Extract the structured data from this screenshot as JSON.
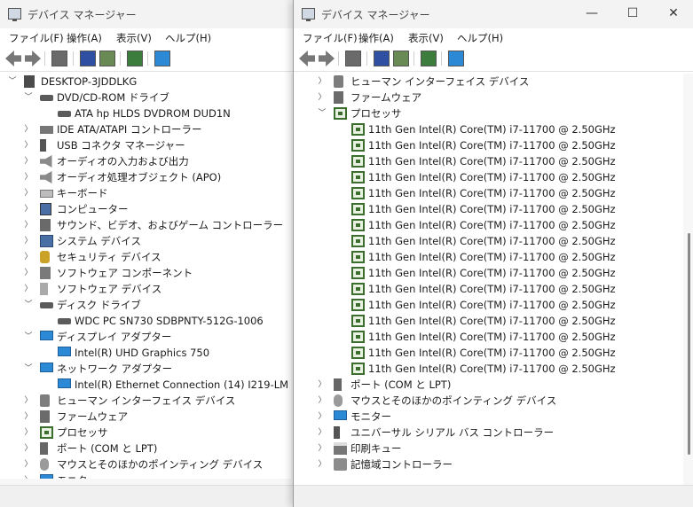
{
  "left": {
    "title": "デバイス マネージャー",
    "menus": [
      "ファイル(F)",
      "操作(A)",
      "表示(V)",
      "ヘルプ(H)"
    ],
    "root": "DESKTOP-3JDDLKG",
    "items": [
      {
        "label": "DVD/CD-ROM ドライブ",
        "state": "expanded",
        "icon": "dvd-drive-icon"
      },
      {
        "label": "ATA hp HLDS DVDROM DUD1N",
        "state": "leaf",
        "icon": "dvd-drive-icon"
      },
      {
        "label": "IDE ATA/ATAPI コントローラー",
        "state": "collapsed",
        "icon": "ide-controller-icon"
      },
      {
        "label": "USB コネクタ マネージャー",
        "state": "collapsed",
        "icon": "usb-icon"
      },
      {
        "label": "オーディオの入力および出力",
        "state": "collapsed",
        "icon": "speaker-icon"
      },
      {
        "label": "オーディオ処理オブジェクト (APO)",
        "state": "collapsed",
        "icon": "speaker-icon"
      },
      {
        "label": "キーボード",
        "state": "collapsed",
        "icon": "keyboard-icon"
      },
      {
        "label": "コンピューター",
        "state": "collapsed",
        "icon": "computer-icon"
      },
      {
        "label": "サウンド、ビデオ、およびゲーム コントローラー",
        "state": "collapsed",
        "icon": "sound-icon"
      },
      {
        "label": "システム デバイス",
        "state": "collapsed",
        "icon": "system-device-icon"
      },
      {
        "label": "セキュリティ デバイス",
        "state": "collapsed",
        "icon": "security-icon"
      },
      {
        "label": "ソフトウェア コンポーネント",
        "state": "collapsed",
        "icon": "software-component-icon"
      },
      {
        "label": "ソフトウェア デバイス",
        "state": "collapsed",
        "icon": "software-device-icon"
      },
      {
        "label": "ディスク ドライブ",
        "state": "expanded",
        "icon": "disk-drive-icon"
      },
      {
        "label": "WDC PC SN730 SDBPNTY-512G-1006",
        "state": "leaf",
        "icon": "disk-drive-icon"
      },
      {
        "label": "ディスプレイ アダプター",
        "state": "expanded",
        "icon": "display-adapter-icon"
      },
      {
        "label": "Intel(R) UHD Graphics 750",
        "state": "leaf",
        "icon": "display-adapter-icon"
      },
      {
        "label": "ネットワーク アダプター",
        "state": "expanded",
        "icon": "network-adapter-icon"
      },
      {
        "label": "Intel(R) Ethernet Connection (14) I219-LM",
        "state": "leaf",
        "icon": "network-adapter-icon"
      },
      {
        "label": "ヒューマン インターフェイス デバイス",
        "state": "collapsed",
        "icon": "hid-icon"
      },
      {
        "label": "ファームウェア",
        "state": "collapsed",
        "icon": "firmware-icon"
      },
      {
        "label": "プロセッサ",
        "state": "collapsed",
        "icon": "processor-icon"
      },
      {
        "label": "ポート (COM と LPT)",
        "state": "collapsed",
        "icon": "port-icon"
      },
      {
        "label": "マウスとそのほかのポインティング デバイス",
        "state": "collapsed",
        "icon": "mouse-icon"
      },
      {
        "label": "モニター",
        "state": "collapsed",
        "icon": "monitor-icon"
      }
    ]
  },
  "right": {
    "title": "デバイス マネージャー",
    "menus": [
      "ファイル(F)",
      "操作(A)",
      "表示(V)",
      "ヘルプ(H)"
    ],
    "items": [
      {
        "label": "ヒューマン インターフェイス デバイス",
        "state": "collapsed",
        "icon": "hid-icon"
      },
      {
        "label": "ファームウェア",
        "state": "collapsed",
        "icon": "firmware-icon"
      },
      {
        "label": "プロセッサ",
        "state": "expanded",
        "icon": "processor-icon"
      },
      {
        "label": "11th Gen Intel(R) Core(TM) i7-11700 @ 2.50GHz",
        "state": "leaf",
        "icon": "processor-icon"
      },
      {
        "label": "11th Gen Intel(R) Core(TM) i7-11700 @ 2.50GHz",
        "state": "leaf",
        "icon": "processor-icon"
      },
      {
        "label": "11th Gen Intel(R) Core(TM) i7-11700 @ 2.50GHz",
        "state": "leaf",
        "icon": "processor-icon"
      },
      {
        "label": "11th Gen Intel(R) Core(TM) i7-11700 @ 2.50GHz",
        "state": "leaf",
        "icon": "processor-icon"
      },
      {
        "label": "11th Gen Intel(R) Core(TM) i7-11700 @ 2.50GHz",
        "state": "leaf",
        "icon": "processor-icon"
      },
      {
        "label": "11th Gen Intel(R) Core(TM) i7-11700 @ 2.50GHz",
        "state": "leaf",
        "icon": "processor-icon"
      },
      {
        "label": "11th Gen Intel(R) Core(TM) i7-11700 @ 2.50GHz",
        "state": "leaf",
        "icon": "processor-icon"
      },
      {
        "label": "11th Gen Intel(R) Core(TM) i7-11700 @ 2.50GHz",
        "state": "leaf",
        "icon": "processor-icon"
      },
      {
        "label": "11th Gen Intel(R) Core(TM) i7-11700 @ 2.50GHz",
        "state": "leaf",
        "icon": "processor-icon"
      },
      {
        "label": "11th Gen Intel(R) Core(TM) i7-11700 @ 2.50GHz",
        "state": "leaf",
        "icon": "processor-icon"
      },
      {
        "label": "11th Gen Intel(R) Core(TM) i7-11700 @ 2.50GHz",
        "state": "leaf",
        "icon": "processor-icon"
      },
      {
        "label": "11th Gen Intel(R) Core(TM) i7-11700 @ 2.50GHz",
        "state": "leaf",
        "icon": "processor-icon"
      },
      {
        "label": "11th Gen Intel(R) Core(TM) i7-11700 @ 2.50GHz",
        "state": "leaf",
        "icon": "processor-icon"
      },
      {
        "label": "11th Gen Intel(R) Core(TM) i7-11700 @ 2.50GHz",
        "state": "leaf",
        "icon": "processor-icon"
      },
      {
        "label": "11th Gen Intel(R) Core(TM) i7-11700 @ 2.50GHz",
        "state": "leaf",
        "icon": "processor-icon"
      },
      {
        "label": "11th Gen Intel(R) Core(TM) i7-11700 @ 2.50GHz",
        "state": "leaf",
        "icon": "processor-icon"
      },
      {
        "label": "ポート (COM と LPT)",
        "state": "collapsed",
        "icon": "port-icon"
      },
      {
        "label": "マウスとそのほかのポインティング デバイス",
        "state": "collapsed",
        "icon": "mouse-icon"
      },
      {
        "label": "モニター",
        "state": "collapsed",
        "icon": "monitor-icon"
      },
      {
        "label": "ユニバーサル シリアル バス コントローラー",
        "state": "collapsed",
        "icon": "usb-icon"
      },
      {
        "label": "印刷キュー",
        "state": "collapsed",
        "icon": "printer-icon"
      },
      {
        "label": "記憶域コントローラー",
        "state": "collapsed",
        "icon": "storage-controller-icon"
      }
    ]
  },
  "caption_buttons": {
    "minimize": "—",
    "maximize": "☐",
    "close": "✕"
  },
  "toolbar_icons": [
    "back-icon",
    "forward-icon",
    "properties-icon",
    "help-icon",
    "show-hide-icon",
    "update-driver-icon",
    "scan-hardware-icon"
  ]
}
